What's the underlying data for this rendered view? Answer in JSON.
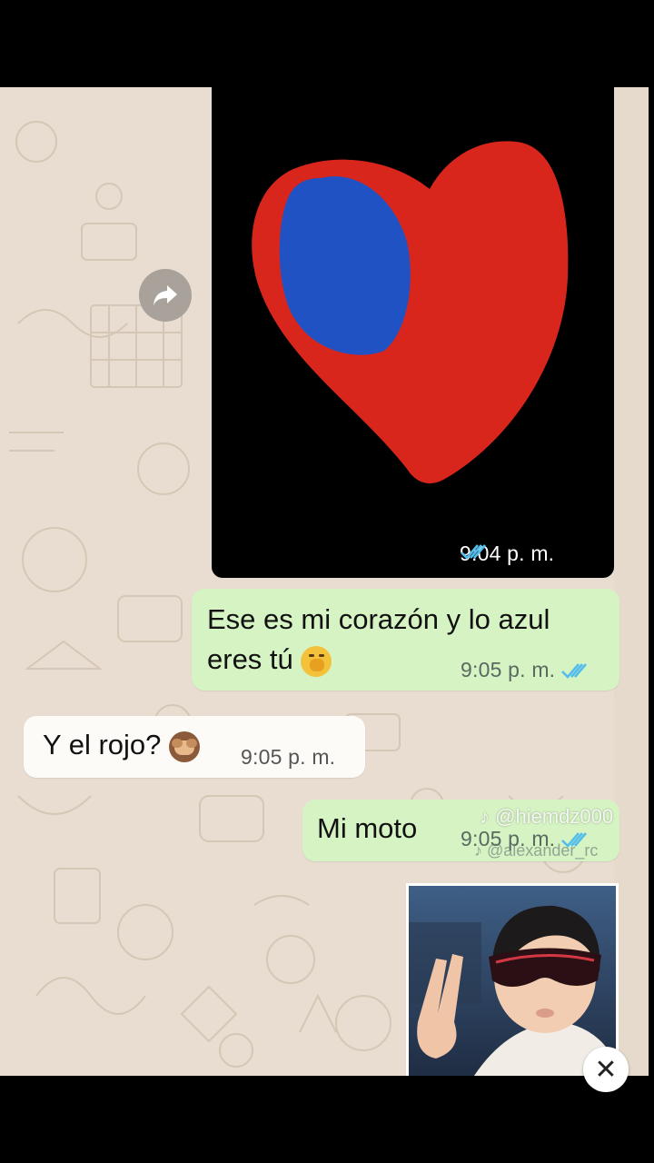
{
  "messages": {
    "heart_image": {
      "time": "9:04 p. m.",
      "status": "read"
    },
    "out_1": {
      "text_line1": "Ese es mi corazón y lo azul",
      "text_line2": "eres tú",
      "emoji": "🤭",
      "time": "9:05 p. m.",
      "status": "read"
    },
    "in_1": {
      "text": "Y el rojo?",
      "emoji": "🙈",
      "time": "9:05 p. m."
    },
    "out_2": {
      "text": "Mi moto",
      "time": "9:05 p. m.",
      "status": "read"
    }
  },
  "watermarks": {
    "primary": "@hiemdz000",
    "secondary": "@alexander_rc"
  },
  "icons": {
    "forward": "forward-arrow-icon",
    "check": "double-check-icon",
    "close": "close-icon",
    "watermark": "tiktok-logo-icon"
  },
  "colors": {
    "outgoing_bubble": "#d6f3c3",
    "incoming_bubble": "#fcfbf8",
    "read_check": "#53bdeb",
    "heart_red": "#d9261d",
    "heart_blue": "#2152c4",
    "wallpaper": "#e8ddd0"
  },
  "close_label": "✕"
}
